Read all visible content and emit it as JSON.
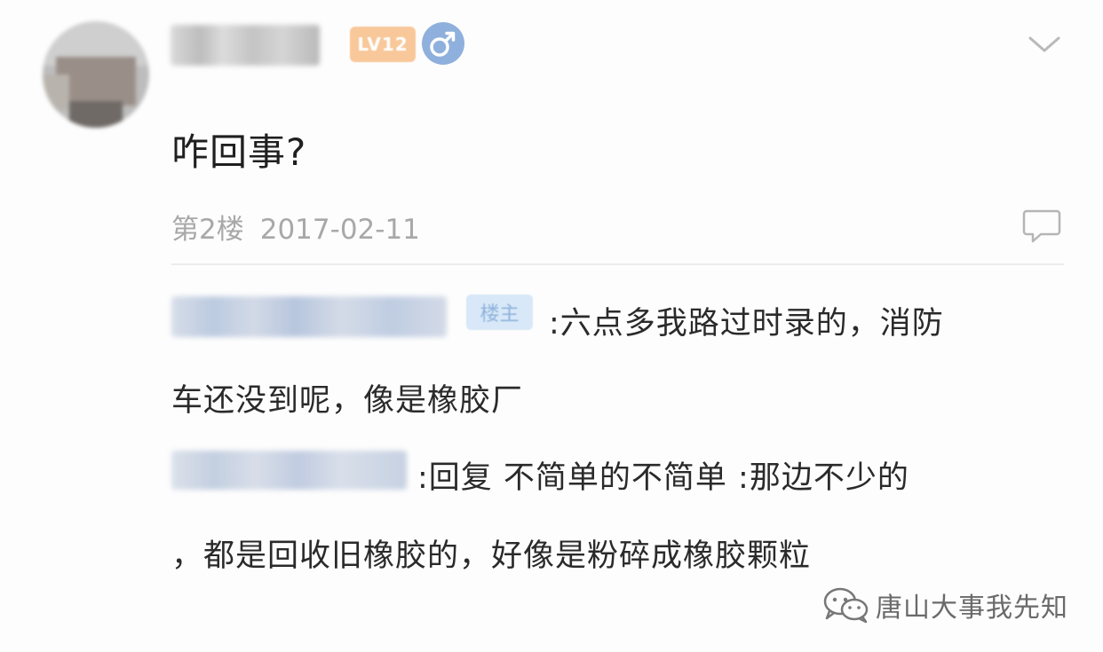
{
  "header": {
    "level_badge": "LV12",
    "gender_icon": "male-symbol-icon",
    "expand_icon": "chevron-down-icon"
  },
  "post": {
    "title": "咋回事?",
    "floor": "第2楼",
    "date": "2017-02-11",
    "comment_icon": "comment-bubble-icon"
  },
  "replies": [
    {
      "badge": "楼主",
      "line1": ":六点多我路过时录的，消防",
      "line2": "车还没到呢，像是橡胶厂"
    },
    {
      "line1": ":回复 不简单的不简单 :那边不少的",
      "line2": "，都是回收旧橡胶的，好像是粉碎成橡胶颗粒"
    }
  ],
  "watermark": {
    "icon": "wechat-icon",
    "text": "唐山大事我先知"
  },
  "colors": {
    "gender_blue": "#8fb0dc",
    "level_orange": "#f8c89a",
    "owner_badge_bg": "#d8e8f8",
    "owner_badge_text": "#8fb3dc",
    "meta_gray": "#a8a8a8",
    "text_dark": "#2a2a2a"
  }
}
